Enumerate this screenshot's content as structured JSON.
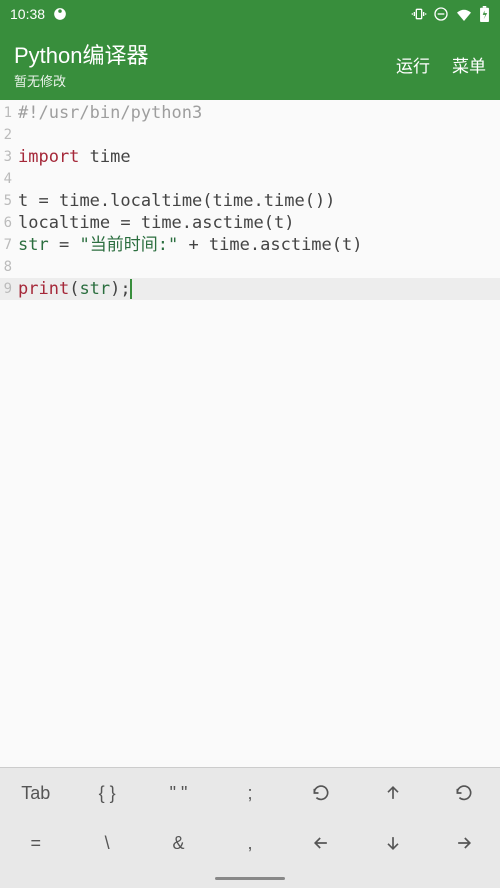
{
  "status_bar": {
    "time": "10:38"
  },
  "header": {
    "title": "Python编译器",
    "subtitle": "暂无修改",
    "run_label": "运行",
    "menu_label": "菜单"
  },
  "editor": {
    "current_line": 9,
    "lines": [
      {
        "n": 1,
        "tokens": [
          {
            "t": "comment",
            "v": "#!/usr/bin/python3"
          }
        ]
      },
      {
        "n": 2,
        "tokens": []
      },
      {
        "n": 3,
        "tokens": [
          {
            "t": "keyword",
            "v": "import"
          },
          {
            "t": "text",
            "v": " time"
          }
        ]
      },
      {
        "n": 4,
        "tokens": []
      },
      {
        "n": 5,
        "tokens": [
          {
            "t": "text",
            "v": "t "
          },
          {
            "t": "op",
            "v": "="
          },
          {
            "t": "text",
            "v": " time"
          },
          {
            "t": "punc",
            "v": "."
          },
          {
            "t": "text",
            "v": "localtime"
          },
          {
            "t": "punc",
            "v": "("
          },
          {
            "t": "text",
            "v": "time"
          },
          {
            "t": "punc",
            "v": "."
          },
          {
            "t": "text",
            "v": "time"
          },
          {
            "t": "punc",
            "v": "())"
          }
        ]
      },
      {
        "n": 6,
        "tokens": [
          {
            "t": "text",
            "v": "localtime "
          },
          {
            "t": "op",
            "v": "="
          },
          {
            "t": "text",
            "v": " time"
          },
          {
            "t": "punc",
            "v": "."
          },
          {
            "t": "text",
            "v": "asctime"
          },
          {
            "t": "punc",
            "v": "("
          },
          {
            "t": "text",
            "v": "t"
          },
          {
            "t": "punc",
            "v": ")"
          }
        ]
      },
      {
        "n": 7,
        "tokens": [
          {
            "t": "builtin",
            "v": "str"
          },
          {
            "t": "text",
            "v": " "
          },
          {
            "t": "op",
            "v": "="
          },
          {
            "t": "text",
            "v": " "
          },
          {
            "t": "string",
            "v": "\"当前时间:\""
          },
          {
            "t": "text",
            "v": " "
          },
          {
            "t": "op",
            "v": "+"
          },
          {
            "t": "text",
            "v": " time"
          },
          {
            "t": "punc",
            "v": "."
          },
          {
            "t": "text",
            "v": "asctime"
          },
          {
            "t": "punc",
            "v": "("
          },
          {
            "t": "text",
            "v": "t"
          },
          {
            "t": "punc",
            "v": ")"
          }
        ]
      },
      {
        "n": 8,
        "tokens": []
      },
      {
        "n": 9,
        "tokens": [
          {
            "t": "keyword",
            "v": "print"
          },
          {
            "t": "punc",
            "v": "("
          },
          {
            "t": "builtin",
            "v": "str"
          },
          {
            "t": "punc",
            "v": ");"
          }
        ]
      }
    ]
  },
  "keyboard": {
    "row1": [
      "Tab",
      "{ }",
      "\" \"",
      ";",
      "refresh-icon",
      "arrow-up-icon",
      "refresh-icon"
    ],
    "row2": [
      "=",
      "\\",
      "&",
      ",",
      "arrow-left-icon",
      "arrow-down-icon",
      "arrow-right-icon"
    ]
  }
}
